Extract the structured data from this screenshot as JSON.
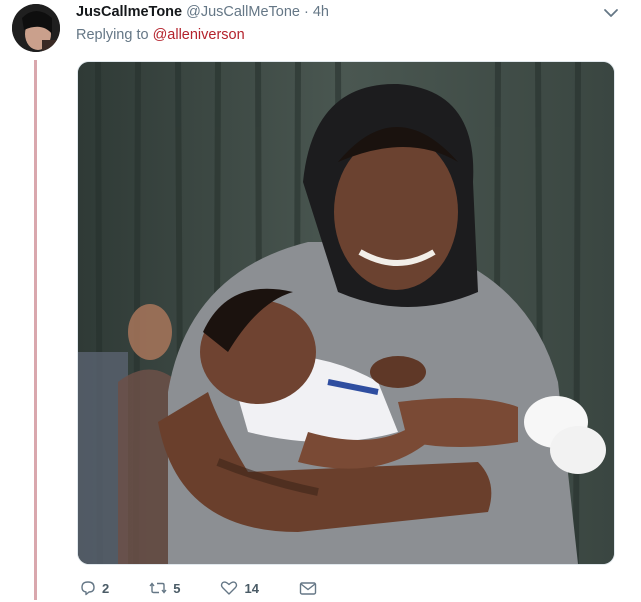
{
  "tweet": {
    "display_name": "JusCallmeTone",
    "handle": "@JusCallMeTone",
    "separator": "·",
    "time": "4h",
    "replying_prefix": "Replying to",
    "replying_handle": "@alleniverson"
  },
  "actions": {
    "reply_count": "2",
    "retweet_count": "5",
    "like_count": "14"
  },
  "icons": [
    "caret-down-icon",
    "reply-icon",
    "retweet-icon",
    "like-icon",
    "dm-icon"
  ],
  "colors": {
    "thread_line": "#d9a7ad",
    "mention": "#b4222c",
    "muted": "#657786"
  }
}
